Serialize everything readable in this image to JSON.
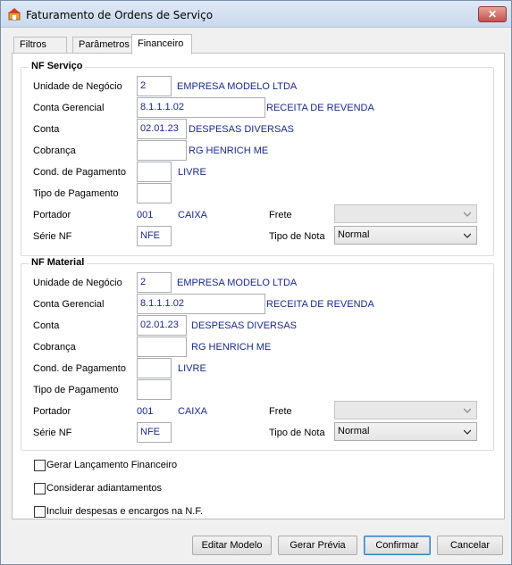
{
  "window": {
    "title": "Faturamento de Ordens de Serviço",
    "close_glyph": "✕"
  },
  "tabs": [
    {
      "label": "Filtros"
    },
    {
      "label": "Parâmetros"
    },
    {
      "label": "Financeiro"
    }
  ],
  "active_tab": "Financeiro",
  "labels": {
    "unidade": "Unidade de Negócio",
    "conta_gerencial": "Conta Gerencial",
    "conta": "Conta",
    "cobranca": "Cobrança",
    "cond_pagamento": "Cond. de Pagamento",
    "tipo_pagamento": "Tipo de Pagamento",
    "portador": "Portador",
    "serie": "Série NF",
    "frete": "Frete",
    "tipo_nota": "Tipo de Nota"
  },
  "nf_servico": {
    "title": "NF Serviço",
    "unidade_code": "2",
    "unidade_name": "EMPRESA MODELO LTDA",
    "conta_gerencial_code": "8.1.1.1.02",
    "conta_gerencial_name": "RECEITA DE REVENDA",
    "conta_code": "02.01.23",
    "conta_name": "DESPESAS DIVERSAS",
    "cobranca_code": "",
    "cobranca_name": "RG HENRICH ME",
    "cond_pagamento_code": "",
    "cond_pagamento_name": "LIVRE",
    "tipo_pagamento_code": "",
    "portador_code": "001",
    "portador_name": "CAIXA",
    "serie": "NFE",
    "frete": "",
    "tipo_nota": "Normal"
  },
  "nf_material": {
    "title": "NF Material",
    "unidade_code": "2",
    "unidade_name": "EMPRESA MODELO LTDA",
    "conta_gerencial_code": "8.1.1.1.02",
    "conta_gerencial_name": "RECEITA DE REVENDA",
    "conta_code": "02.01.23",
    "conta_name": "DESPESAS DIVERSAS",
    "cobranca_code": "",
    "cobranca_name": "RG HENRICH ME",
    "cond_pagamento_code": "",
    "cond_pagamento_name": "LIVRE",
    "tipo_pagamento_code": "",
    "portador_code": "001",
    "portador_name": "CAIXA",
    "serie": "NFE",
    "frete": "",
    "tipo_nota": "Normal"
  },
  "checkboxes": [
    {
      "label": "Gerar Lançamento Financeiro",
      "checked": false
    },
    {
      "label": "Considerar adiantamentos",
      "checked": false
    },
    {
      "label": "Incluir despesas e encargos na N.F.",
      "checked": false
    }
  ],
  "buttons": {
    "editar_modelo": "Editar Modelo",
    "gerar_previa": "Gerar Prévia",
    "confirmar": "Confirmar",
    "cancelar": "Cancelar"
  },
  "colors": {
    "value_text": "#1a2a8a",
    "title_gradient_top": "#dfe9f5",
    "close_button": "#c75050"
  }
}
